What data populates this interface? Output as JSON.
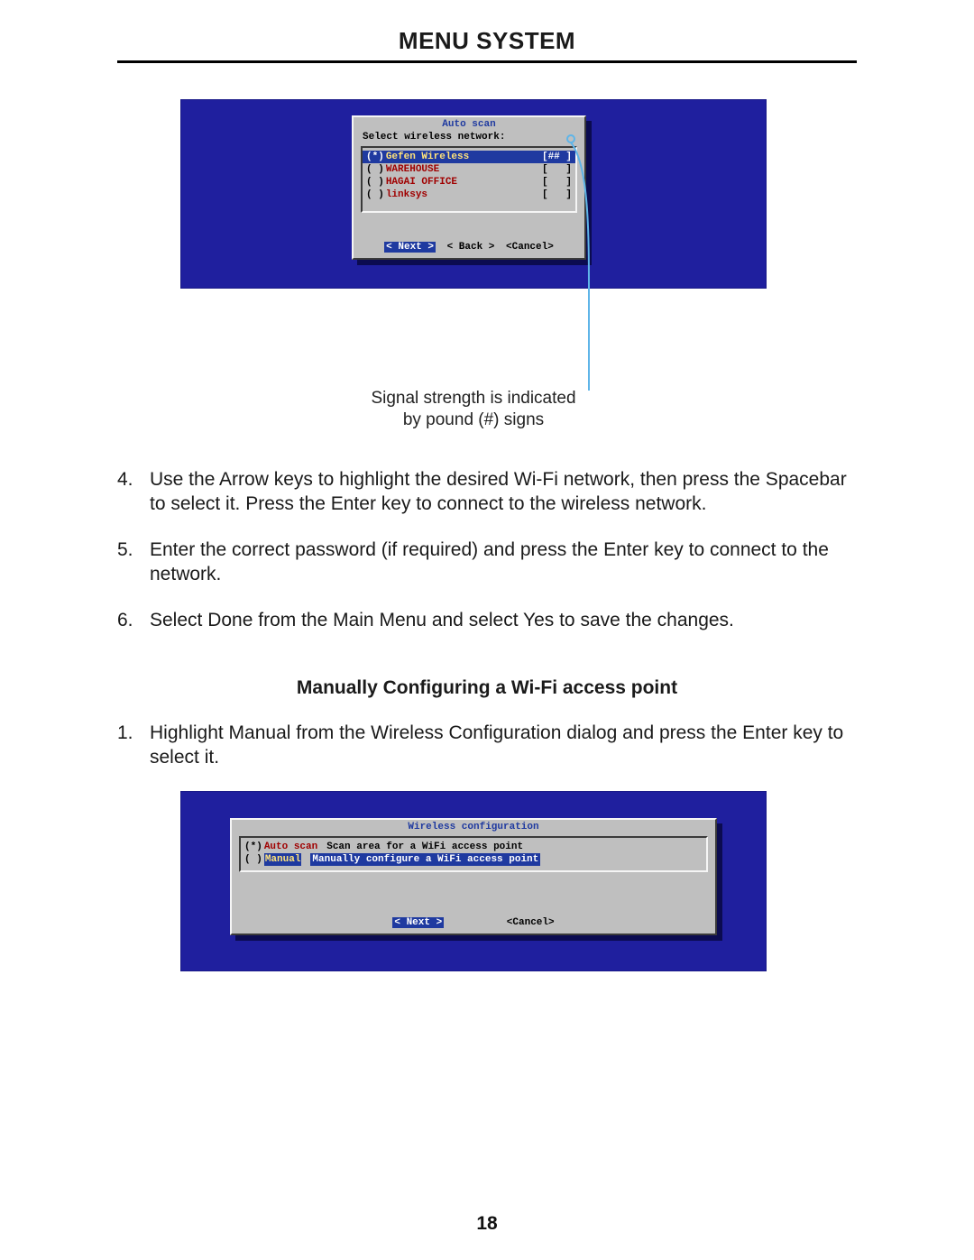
{
  "header": {
    "title": "MENU SYSTEM"
  },
  "top_screenshot": {
    "dialog_title": "Auto scan",
    "prompt": "Select wireless network:",
    "networks": [
      {
        "radio": "(*)",
        "name": "Gefen Wireless",
        "signal": "[## ]",
        "selected": true
      },
      {
        "radio": "( )",
        "name": "WAREHOUSE",
        "signal": "[   ]",
        "selected": false
      },
      {
        "radio": "( )",
        "name": "HAGAI OFFICE",
        "signal": "[   ]",
        "selected": false
      },
      {
        "radio": "( )",
        "name": "linksys",
        "signal": "[   ]",
        "selected": false
      }
    ],
    "buttons": {
      "next": "< Next >",
      "back": "< Back >",
      "cancel": "<Cancel>"
    }
  },
  "callout": {
    "line1": "Signal strength is indicated",
    "line2": "by pound (#) signs"
  },
  "steps_a": [
    {
      "num": "4.",
      "text": "Use the Arrow keys to highlight the desired Wi-Fi network, then press the Spacebar to select it.  Press the Enter key to connect to the wireless network."
    },
    {
      "num": "5.",
      "text": "Enter the correct password (if required) and press the Enter key to connect to the network."
    },
    {
      "num": "6.",
      "text": "Select Done from the Main Menu and select Yes to save the changes."
    }
  ],
  "subheading": "Manually Configuring a Wi-Fi access point",
  "steps_b": [
    {
      "num": "1.",
      "text": "Highlight Manual from the Wireless Configuration dialog and press the Enter key to select it."
    }
  ],
  "bot_screenshot": {
    "dialog_title": "Wireless configuration",
    "options": [
      {
        "radio": "(*)",
        "label": "Auto scan",
        "desc": "Scan area for a WiFi access point",
        "selected": false
      },
      {
        "radio": "( )",
        "label": "Manual",
        "desc": "Manually configure a WiFi access point",
        "selected": true
      }
    ],
    "buttons": {
      "next": "< Next >",
      "cancel": "<Cancel>"
    }
  },
  "page_number": "18"
}
